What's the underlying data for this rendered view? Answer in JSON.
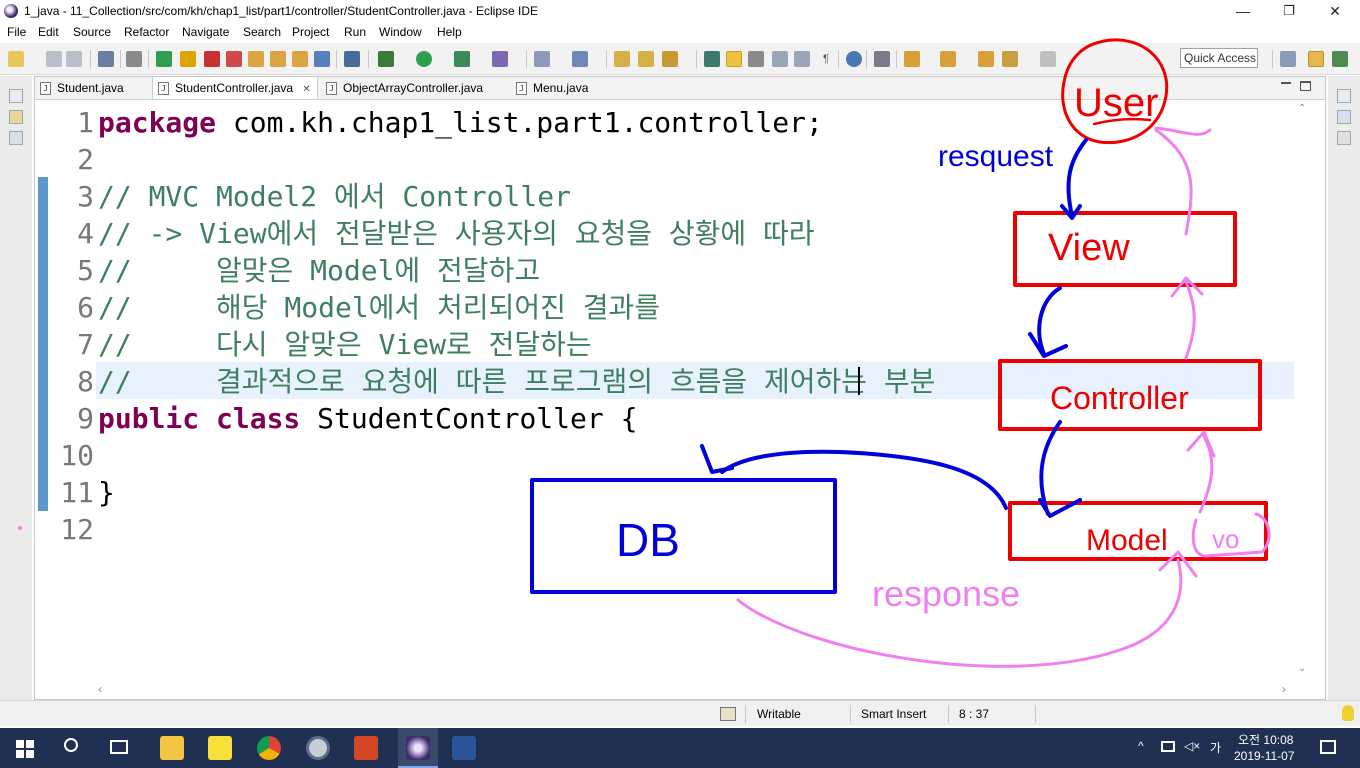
{
  "window": {
    "title": "1_java - 11_Collection/src/com/kh/chap1_list/part1/controller/StudentController.java - Eclipse IDE",
    "minimize": "—",
    "maximize": "❐",
    "close": "✕"
  },
  "menu": [
    "File",
    "Edit",
    "Source",
    "Refactor",
    "Navigate",
    "Search",
    "Project",
    "Run",
    "Window",
    "Help"
  ],
  "toolbar": {
    "quick_access": "Quick Access"
  },
  "tabs": [
    {
      "label": "Student.java"
    },
    {
      "label": "StudentController.java",
      "active": true,
      "close": "✕"
    },
    {
      "label": "ObjectArrayController.java"
    },
    {
      "label": "Menu.java"
    }
  ],
  "editor": {
    "line_numbers": [
      "1",
      "2",
      "3",
      "4",
      "5",
      "6",
      "7",
      "8",
      "9",
      "10",
      "11",
      "12"
    ],
    "lines": [
      {
        "kw": "package",
        "rest": " com.kh.chap1_list.part1.controller;"
      },
      {
        "text": ""
      },
      {
        "comment": "// MVC Model2 에서 Controller"
      },
      {
        "comment": "// -> View에서 전달받은 사용자의 요청을 상황에 따라"
      },
      {
        "comment": "//     알맞은 Model에 전달하고"
      },
      {
        "comment": "//     해당 Model에서 처리되어진 결과를"
      },
      {
        "comment": "//     다시 알맞은 View로 전달하는"
      },
      {
        "comment": "//     결과적으로 요청에 따른 프로그램의 흐름을 제어하는 부분"
      },
      {
        "kw": "public class",
        "rest": " StudentController {"
      },
      {
        "text": ""
      },
      {
        "text": "}"
      },
      {
        "text": ""
      }
    ],
    "current_line": 8
  },
  "annotations": {
    "user": "User",
    "request": "resquest",
    "view": "View",
    "controller": "Controller",
    "model": "Model",
    "vo": "vo",
    "db": "DB",
    "response": "response",
    "colors": {
      "red": "#ee0000",
      "blue": "#0000dd",
      "pink": "#f080f0"
    }
  },
  "status": {
    "writable": "Writable",
    "insert_mode": "Smart Insert",
    "position": "8 : 37"
  },
  "taskbar": {
    "ime_mode": "가",
    "time": "오전 10:08",
    "date": "2019-11-07"
  }
}
